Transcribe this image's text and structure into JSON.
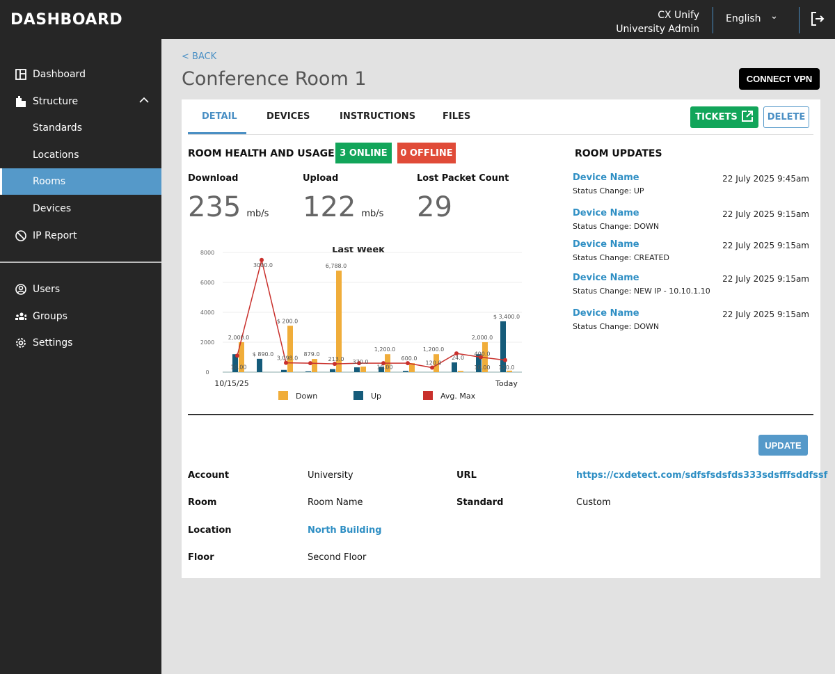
{
  "header": {
    "logo": "DASHBOARD",
    "org": "CX Unify",
    "role": "University Admin",
    "language": "English"
  },
  "sidebar": {
    "items": [
      {
        "label": "Dashboard",
        "icon": "dashboard-icon"
      },
      {
        "label": "Structure",
        "icon": "building-icon",
        "expanded": true
      },
      {
        "label": "Standards",
        "sub": true
      },
      {
        "label": "Locations",
        "sub": true
      },
      {
        "label": "Rooms",
        "sub": true,
        "active": true
      },
      {
        "label": "Devices",
        "sub": true
      },
      {
        "label": "IP Report",
        "icon": "ip-report-icon"
      },
      {
        "label": "Users",
        "icon": "user-icon"
      },
      {
        "label": "Groups",
        "icon": "groups-icon"
      },
      {
        "label": "Settings",
        "icon": "gear-icon"
      }
    ]
  },
  "page": {
    "back": "< BACK",
    "title": "Conference Room 1",
    "connect_vpn": "CONNECT VPN"
  },
  "tabs": [
    {
      "label": "DETAIL",
      "active": true
    },
    {
      "label": "DEVICES"
    },
    {
      "label": "INSTRUCTIONS"
    },
    {
      "label": "FILES"
    }
  ],
  "actions": {
    "tickets": "TICKETS",
    "delete": "DELETE",
    "update": "UPDATE"
  },
  "health": {
    "title": "ROOM HEALTH AND USAGE",
    "online": "3 ONLINE",
    "offline": "0 OFFLINE",
    "metrics": [
      {
        "label": "Download",
        "value": "235",
        "unit": "mb/s"
      },
      {
        "label": "Upload",
        "value": "122",
        "unit": "mb/s"
      },
      {
        "label": "Lost Packet Count",
        "value": "29",
        "unit": ""
      }
    ]
  },
  "colors": {
    "accent": "#4a8fc4",
    "online": "#12a55a",
    "offline": "#e04b38",
    "down": "#f0ad3a",
    "up": "#155b7a",
    "avg": "#c9302c"
  },
  "chart_data": {
    "type": "bar",
    "title": "Last Week",
    "ylim": [
      0,
      8000
    ],
    "yticks": [
      "0",
      "2000",
      "4000",
      "6000",
      "8000"
    ],
    "x_labels": [
      "10/15/25",
      "Today"
    ],
    "grid": true,
    "legend": "bottom",
    "series": [
      {
        "name": "Down",
        "type": "bar",
        "values": [
          2000,
          0,
          3098,
          879,
          6788,
          370,
          1200,
          600,
          1200,
          80,
          2000,
          100
        ]
      },
      {
        "name": "Up",
        "type": "bar",
        "values": [
          1200,
          890,
          150,
          50,
          200,
          320,
          350,
          80,
          0,
          650,
          1200,
          3400
        ]
      },
      {
        "name": "Avg. Max",
        "type": "line",
        "values": [
          1100,
          7500,
          620,
          600,
          550,
          600,
          600,
          600,
          300,
          1250,
          1000,
          800
        ]
      }
    ],
    "data_labels": [
      [
        "2,000.0",
        "10.00"
      ],
      [
        "$ 890.0",
        "3000.0"
      ],
      [
        "$ 200.0",
        "3,098.0"
      ],
      [
        "879.0"
      ],
      [
        "213.0",
        "6,788.0"
      ],
      [
        "370.0"
      ],
      [
        "1,200.0",
        "10.00"
      ],
      [
        "600.0"
      ],
      [
        "120.0",
        "1,200.0"
      ],
      [
        "24.0"
      ],
      [
        "2,000.0",
        "400.0",
        "10.00"
      ],
      [
        "$ 3,400.0",
        "120.0"
      ]
    ]
  },
  "updates": {
    "title": "ROOM UPDATES",
    "items": [
      {
        "device": "Device Name",
        "status": "Status Change: UP",
        "date": "22 July 2025 9:45am"
      },
      {
        "device": "Device Name",
        "status": "Status Change: DOWN",
        "date": "22 July 2025 9:15am"
      },
      {
        "device": "Device Name",
        "status": "Status Change: CREATED",
        "date": "22 July 2025 9:15am"
      },
      {
        "device": "Device Name",
        "status": "Status Change: NEW IP - 10.10.1.10",
        "date": "22 July 2025 9:15am"
      },
      {
        "device": "Device Name",
        "status": "Status Change: DOWN",
        "date": "22 July 2025 9:15am"
      }
    ]
  },
  "details": {
    "account_label": "Account",
    "account": "University",
    "room_label": "Room",
    "room": "Room Name",
    "location_label": "Location",
    "location": "North Building",
    "floor_label": "Floor",
    "floor": "Second Floor",
    "url_label": "URL",
    "url": "https://cxdetect.com/sdfsfsdsfds333sdsfffsddfssf",
    "standard_label": "Standard",
    "standard": "Custom"
  }
}
